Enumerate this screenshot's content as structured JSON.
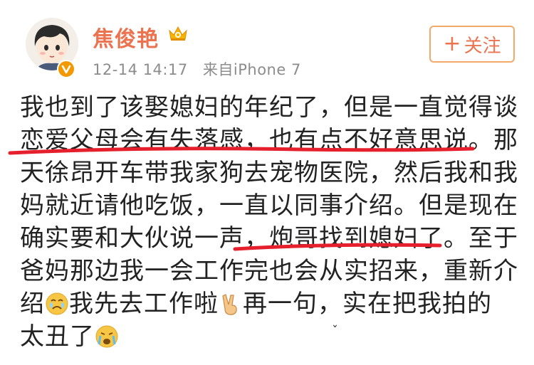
{
  "post": {
    "author": {
      "name": "焦俊艳",
      "avatar_icon": "cartoon-girl-avatar",
      "verified_icon": "orange-verified-badge",
      "vip_icon": "crown-vip-icon"
    },
    "timestamp": "12-14 14:17",
    "source": "来自iPhone 7",
    "follow_label": "关注",
    "content_lines": [
      "我也到了该娶媳妇的年纪了，但是一直觉得谈",
      "恋爱父母会有失落感，也有点不好意思说。那",
      "天徐昂开车带我家狗去宠物医院，然后我和我",
      "妈就近请他吃饭，一直以同事介绍。但是现在",
      "确实要和大伙说一声，炮哥找到媳妇了。至于",
      "爸妈那边我一会工作完也会从实招来，重新介"
    ],
    "line7": {
      "before": "绍",
      "emoji1": "crying-face-emoji",
      "middle": "我先去工作啦",
      "emoji2": "victory-hand-emoji",
      "after": "再一句，实在把我拍的"
    },
    "line8": {
      "text": "太丑了",
      "emoji": "tearful-face-emoji"
    }
  },
  "colors": {
    "accent": "#eb7350",
    "underline": "#e5202c",
    "meta": "#8c8c8c"
  }
}
